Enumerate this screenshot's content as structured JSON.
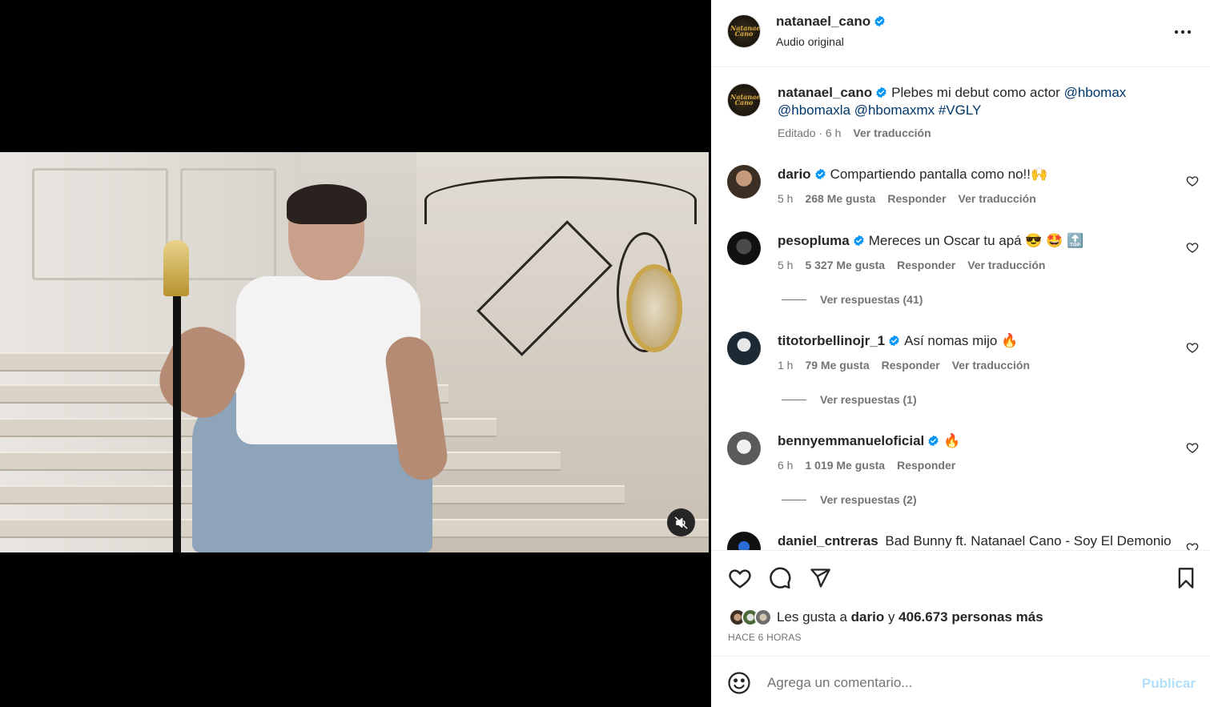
{
  "post": {
    "author": "natanael_cano",
    "audio": "Audio original",
    "avatar_text": "Natanael Cano",
    "caption_text": "Plebes mi debut como actor",
    "caption_mentions": [
      "@hbomax",
      "@hbomaxla",
      "@hbomaxmx",
      "#VGLY"
    ],
    "caption_meta_time": "Editado · 6 h",
    "caption_translate": "Ver traducción"
  },
  "comments": [
    {
      "user": "dario",
      "text": "Compartiendo pantalla como no!!🙌",
      "time": "5 h",
      "likes": "268 Me gusta",
      "reply": "Responder",
      "translate": "Ver traducción"
    },
    {
      "user": "pesopluma",
      "text": "Mereces un Oscar tu apá 😎 🤩 🔝",
      "time": "5 h",
      "likes": "5 327 Me gusta",
      "reply": "Responder",
      "translate": "Ver traducción",
      "replies": "Ver respuestas (41)"
    },
    {
      "user": "titotorbellinojr_1",
      "text": "Así nomas mijo 🔥",
      "time": "1 h",
      "likes": "79 Me gusta",
      "reply": "Responder",
      "translate": "Ver traducción",
      "replies": "Ver respuestas (1)"
    },
    {
      "user": "bennyemmanueloficial",
      "text": "🔥",
      "time": "6 h",
      "likes": "1 019 Me gusta",
      "reply": "Responder",
      "replies": "Ver respuestas (2)"
    },
    {
      "user": "daniel_cntreras",
      "text": "Bad Bunny ft. Natanael Cano - Soy El Demonio"
    }
  ],
  "likes": {
    "prefix": "Les gusta a",
    "user": "dario",
    "joiner": "y",
    "rest": "406.673 personas más"
  },
  "time_ago": "HACE 6 HORAS",
  "composer": {
    "placeholder": "Agrega un comentario...",
    "publish": "Publicar"
  },
  "colors": {
    "verified": "#0095f6",
    "link": "#00376b",
    "muted": "#737373",
    "publish_disabled": "#b2dffc"
  }
}
